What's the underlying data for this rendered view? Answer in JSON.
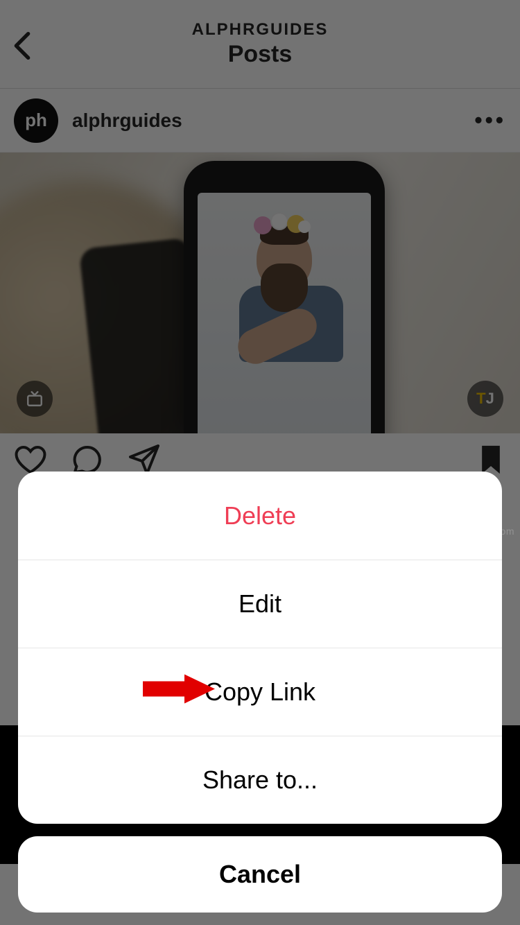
{
  "header": {
    "subtitle": "ALPHRGUIDES",
    "title": "Posts"
  },
  "post": {
    "username": "alphrguides",
    "avatar_text": "ph",
    "badge_right_a": "T",
    "badge_right_b": "J"
  },
  "sheet": {
    "delete": "Delete",
    "edit": "Edit",
    "copy_link": "Copy Link",
    "share_to": "Share to...",
    "cancel": "Cancel"
  },
  "watermark": "www.deuaq.com"
}
